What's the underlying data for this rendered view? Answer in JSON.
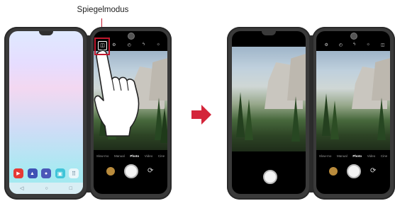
{
  "callout": {
    "label": "Spiegelmodus"
  },
  "camera": {
    "mirror_icon_text": "◫",
    "modes": [
      "Slow-mo",
      "Manual",
      "Photo",
      "Video",
      "Cine"
    ],
    "active_mode_index": 2,
    "top_icons": [
      "settings-icon",
      "timer-icon",
      "flash-icon",
      "hdr-icon",
      "mirror-mode-icon"
    ]
  },
  "home": {
    "dock_icons": [
      {
        "name": "youtube-icon",
        "color": "#e53935",
        "glyph": "▶"
      },
      {
        "name": "gallery-icon",
        "color": "#3f51b5",
        "glyph": "▲"
      },
      {
        "name": "game-icon",
        "color": "#5c6bc0",
        "glyph": "●"
      },
      {
        "name": "dual-screen-icon",
        "color": "#26c6da",
        "glyph": "▣"
      },
      {
        "name": "apps-icon",
        "color": "#e0f2f7",
        "glyph": "⠿"
      }
    ],
    "nav": [
      "◁",
      "○",
      "□"
    ]
  }
}
